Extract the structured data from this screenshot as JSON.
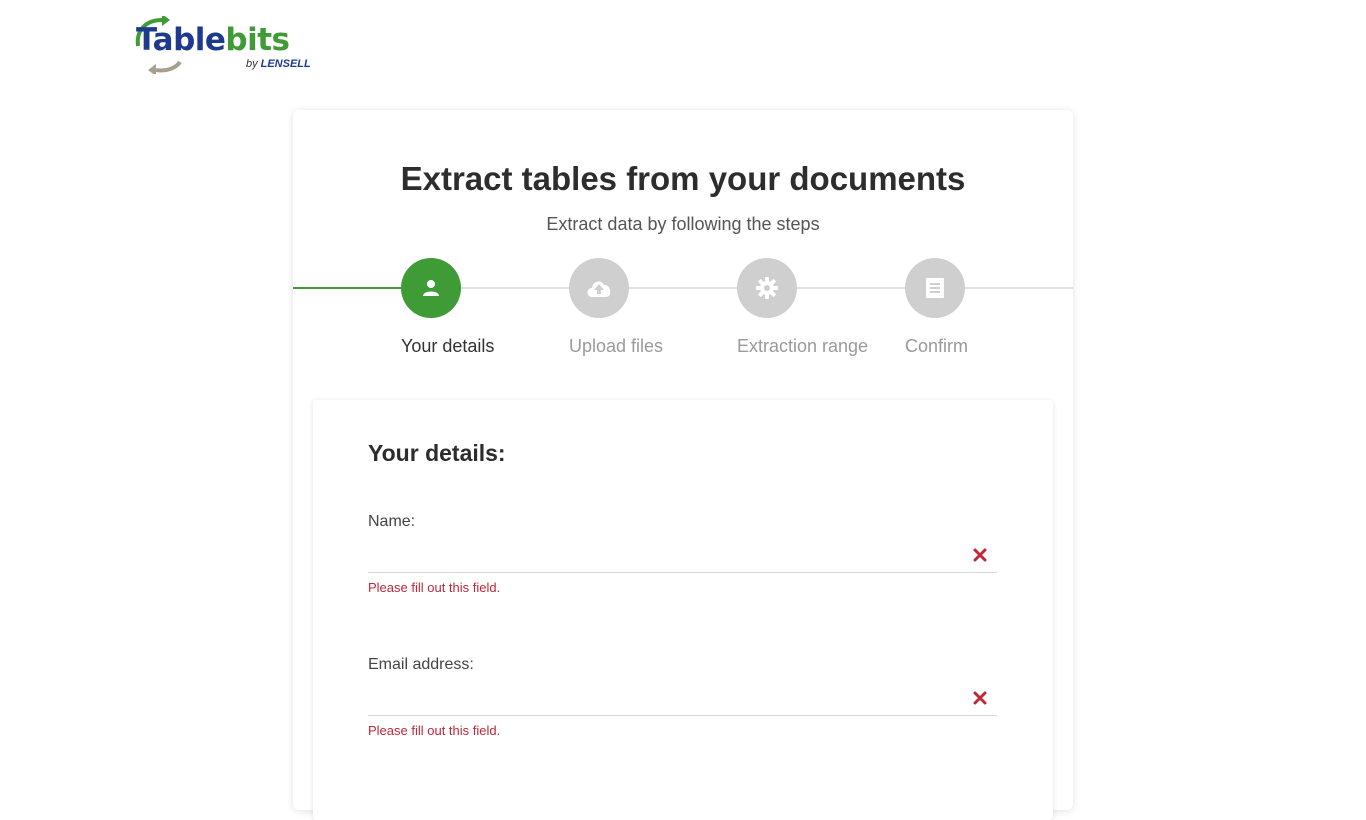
{
  "logo": {
    "part1": "Table",
    "part2": "bits",
    "by": "by",
    "brand": "LENSELL"
  },
  "header": {
    "title": "Extract tables from your documents",
    "subtitle": "Extract data by following the steps"
  },
  "steps": [
    {
      "label": "Your details",
      "icon": "user-icon",
      "active": true
    },
    {
      "label": "Upload files",
      "icon": "cloud-upload-icon",
      "active": false
    },
    {
      "label": "Extraction range",
      "icon": "gear-icon",
      "active": false
    },
    {
      "label": "Confirm",
      "icon": "document-icon",
      "active": false
    }
  ],
  "form": {
    "title": "Your details:",
    "fields": [
      {
        "label": "Name:",
        "value": "",
        "error": "Please fill out this field."
      },
      {
        "label": "Email address:",
        "value": "",
        "error": "Please fill out this field."
      }
    ]
  },
  "colors": {
    "accent": "#3e9b35",
    "brand_blue": "#1f3a8c",
    "inactive": "#cfcfcf",
    "error": "#c0283a"
  }
}
